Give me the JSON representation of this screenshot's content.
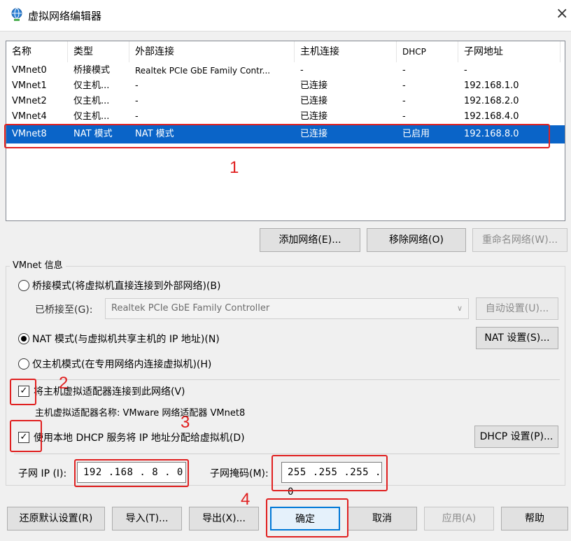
{
  "window": {
    "title": "虚拟网络编辑器",
    "close_glyph": "×",
    "icon": "globe-network-icon"
  },
  "list": {
    "columns": [
      "名称",
      "类型",
      "外部连接",
      "主机连接",
      "DHCP",
      "子网地址"
    ],
    "rows": [
      [
        "VMnet0",
        "桥接模式",
        "Realtek PCIe GbE Family Contr...",
        "-",
        "-",
        "-"
      ],
      [
        "VMnet1",
        "仅主机...",
        "-",
        "已连接",
        "-",
        "192.168.1.0"
      ],
      [
        "VMnet2",
        "仅主机...",
        "-",
        "已连接",
        "-",
        "192.168.2.0"
      ],
      [
        "VMnet4",
        "仅主机...",
        "-",
        "已连接",
        "-",
        "192.168.4.0"
      ],
      [
        "VMnet8",
        "NAT 模式",
        "NAT 模式",
        "已连接",
        "已启用",
        "192.168.8.0"
      ]
    ],
    "selected_index": 4
  },
  "list_buttons": {
    "add": "添加网络(E)...",
    "remove": "移除网络(O)",
    "rename": "重命名网络(W)..."
  },
  "info": {
    "group_label": "VMnet 信息",
    "bridged_label": "桥接模式(将虚拟机直接连接到外部网络)(B)",
    "bridged_to_label": "已桥接至(G):",
    "bridged_to_value": "Realtek PCIe GbE Family Controller",
    "auto_button": "自动设置(U)...",
    "nat_label": "NAT 模式(与虚拟机共享主机的 IP 地址)(N)",
    "nat_button": "NAT 设置(S)...",
    "hostonly_label": "仅主机模式(在专用网络内连接虚拟机)(H)",
    "connect_adapter_label": "将主机虚拟适配器连接到此网络(V)",
    "adapter_name_label": "主机虚拟适配器名称: VMware 网络适配器 VMnet8",
    "dhcp_label": "使用本地 DHCP 服务将 IP 地址分配给虚拟机(D)",
    "dhcp_button": "DHCP 设置(P)...",
    "subnet_ip_label": "子网 IP (I):",
    "subnet_ip_value": "192 .168 . 8  .  0",
    "subnet_mask_label": "子网掩码(M):",
    "subnet_mask_value": "255 .255 .255 .  0",
    "mode_selected": "nat",
    "connect_adapter_checked": true,
    "dhcp_checked": true
  },
  "bottom_buttons": {
    "restore": "还原默认设置(R)",
    "import": "导入(T)...",
    "export": "导出(X)...",
    "ok": "确定",
    "cancel": "取消",
    "apply": "应用(A)",
    "help": "帮助"
  },
  "annotations": {
    "n1": "1",
    "n2": "2",
    "n3": "3",
    "n4": "4",
    "color": "#e02020"
  }
}
